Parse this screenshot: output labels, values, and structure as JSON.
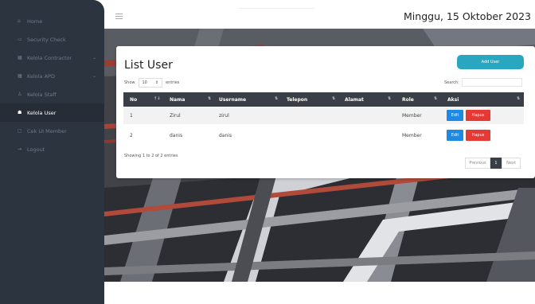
{
  "sidebar": {
    "items": [
      {
        "label": "Home",
        "icon": "home-icon",
        "glyph": "⌂"
      },
      {
        "label": "Security Check",
        "icon": "shield-icon",
        "glyph": "▭"
      },
      {
        "label": "Kelola Contractor",
        "icon": "grid-icon",
        "glyph": "▦",
        "has_chevron": true
      },
      {
        "label": "Kelola APD",
        "icon": "grid-icon",
        "glyph": "▦",
        "has_chevron": true
      },
      {
        "label": "Kelola Staff",
        "icon": "user-icon",
        "glyph": "♙"
      },
      {
        "label": "Kelola User",
        "icon": "users-icon",
        "glyph": "☗",
        "active": true
      },
      {
        "label": "Cek UI Member",
        "icon": "monitor-icon",
        "glyph": "▢"
      },
      {
        "label": "Logout",
        "icon": "logout-icon",
        "glyph": "⇥"
      }
    ]
  },
  "header": {
    "date": "Minggu, 15 Oktober 2023"
  },
  "card": {
    "title": "List User",
    "add_button": "Add User",
    "show_label": "Show",
    "entries_value": "10",
    "entries_label": "entries",
    "search_label": "Search:",
    "search_placeholder": ""
  },
  "table": {
    "headers": [
      "No",
      "Nama",
      "Username",
      "Telepon",
      "Alamat",
      "Role",
      "Aksi"
    ],
    "rows": [
      {
        "no": "1",
        "nama": "Zirul",
        "username": "zirul",
        "telepon": "",
        "alamat": "",
        "role": "Member"
      },
      {
        "no": "2",
        "nama": "danis",
        "username": "danis",
        "telepon": "",
        "alamat": "",
        "role": "Member"
      }
    ],
    "edit_label": "Edit",
    "delete_label": "Hapus"
  },
  "footer_info": "Showing 1 to 2 of 2 entries",
  "pagination": {
    "previous": "Previous",
    "current": "1",
    "next": "Next"
  },
  "colors": {
    "sidebar": "#2c3440",
    "accent": "#2aa7c0",
    "edit": "#1e88e5",
    "delete": "#e53935"
  }
}
